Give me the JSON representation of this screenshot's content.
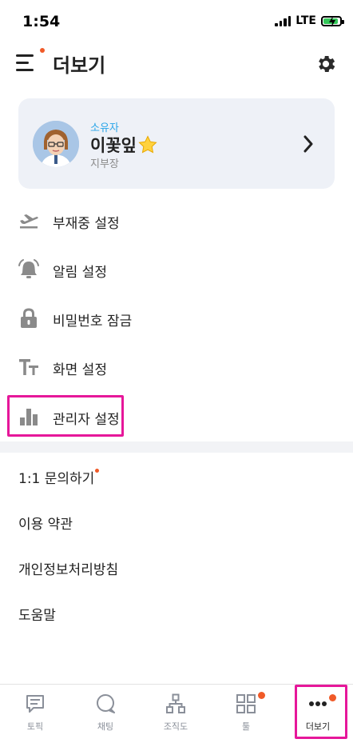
{
  "status_bar": {
    "time": "1:54",
    "network": "LTE"
  },
  "header": {
    "title": "더보기"
  },
  "profile": {
    "role": "소유자",
    "name": "이꽃잎",
    "position": "지부장"
  },
  "menu": [
    {
      "label": "부재중 설정",
      "icon": "airplane-icon"
    },
    {
      "label": "알림 설정",
      "icon": "bell-icon"
    },
    {
      "label": "비밀번호 잠금",
      "icon": "lock-icon"
    },
    {
      "label": "화면 설정",
      "icon": "text-size-icon"
    },
    {
      "label": "관리자 설정",
      "icon": "bar-chart-icon"
    }
  ],
  "links": [
    {
      "label": "1:1 문의하기",
      "new": true
    },
    {
      "label": "이용 약관"
    },
    {
      "label": "개인정보처리방침"
    },
    {
      "label": "도움말"
    }
  ],
  "bottom_nav": [
    {
      "label": "토픽",
      "icon": "topic-icon"
    },
    {
      "label": "채팅",
      "icon": "chat-icon"
    },
    {
      "label": "조직도",
      "icon": "org-chart-icon"
    },
    {
      "label": "툴",
      "icon": "tools-icon",
      "badge": true
    },
    {
      "label": "더보기",
      "icon": "more-icon",
      "badge": true,
      "active": true
    }
  ],
  "colors": {
    "accent": "#2aa5e8",
    "badge": "#f05a28",
    "highlight": "#e6179a",
    "card_bg": "#eef1f7",
    "icon_gray": "#8a8a8a"
  }
}
